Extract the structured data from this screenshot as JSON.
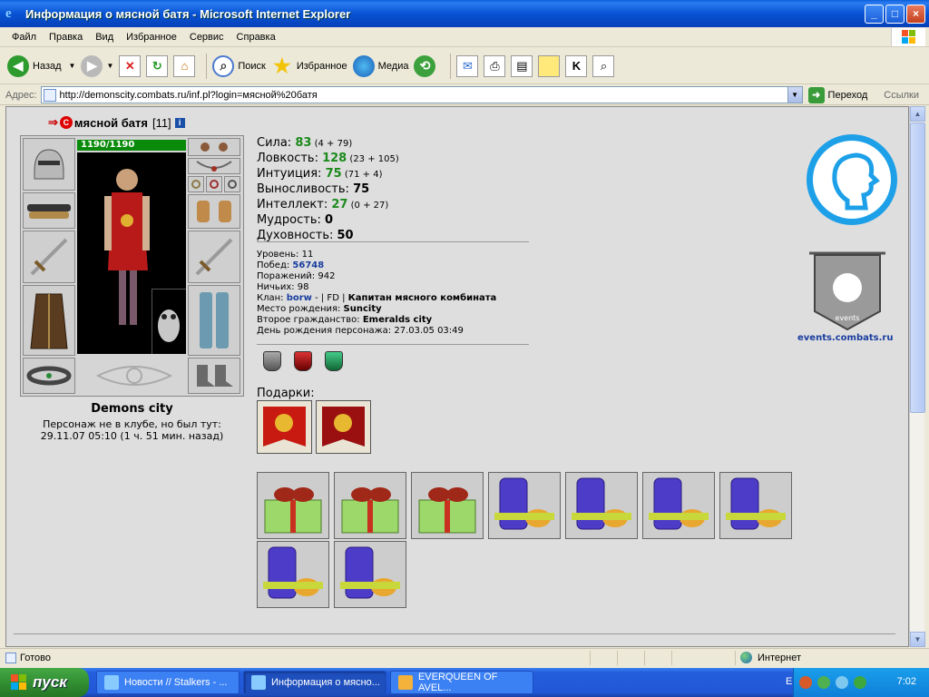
{
  "window": {
    "title": "Информация о мясной батя - Microsoft Internet Explorer"
  },
  "menu": [
    "Файл",
    "Правка",
    "Вид",
    "Избранное",
    "Сервис",
    "Справка"
  ],
  "toolbar": {
    "back": "Назад",
    "search": "Поиск",
    "favorites": "Избранное",
    "media": "Медиа"
  },
  "address": {
    "label": "Адрес:",
    "url": "http://demonscity.combats.ru/inf.pl?login=мясной%20батя",
    "go": "Переход",
    "links": "Ссылки"
  },
  "character": {
    "name": "мясной батя",
    "level": "[11]",
    "hp": "1190/1190",
    "city": "Demons city",
    "online_line1": "Персонаж не в клубе, но был тут:",
    "online_line2": "29.11.07 05:10 (1 ч. 51 мин. назад)"
  },
  "stats": [
    {
      "label": "Сила: ",
      "value": "83",
      "extra": " (4 + 79)",
      "green": true
    },
    {
      "label": "Ловкость: ",
      "value": "128",
      "extra": " (23 + 105)",
      "green": true
    },
    {
      "label": "Интуиция: ",
      "value": "75",
      "extra": " (71 + 4)",
      "green": true
    },
    {
      "label": "Выносливость: ",
      "value": "75",
      "extra": "",
      "green": false
    },
    {
      "label": "Интеллект: ",
      "value": "27",
      "extra": " (0 + 27)",
      "green": true
    },
    {
      "label": "Мудрость: ",
      "value": "0",
      "extra": "",
      "green": false
    },
    {
      "label": "Духовность: ",
      "value": "50",
      "extra": "",
      "green": false
    }
  ],
  "details": {
    "level_label": "Уровень: ",
    "level": "11",
    "wins_label": "Побед: ",
    "wins": "56748",
    "losses_label": "Поражений: ",
    "losses": "942",
    "draws_label": "Ничьих: ",
    "draws": "98",
    "clan_label": "Клан: ",
    "clan": "borw",
    "clan_sep": " - | FD | ",
    "clan_title": "Капитан мясного комбината",
    "birthplace_label": "Место рождения: ",
    "birthplace": "Suncity",
    "second_label": "Второе гражданство: ",
    "second": "Emeralds city",
    "birthday_label": "День рождения персонажа: ",
    "birthday": "27.03.05 03:49"
  },
  "gifts_label": "Подарки:",
  "events_link": "events.combats.ru",
  "events_logo_text": "events",
  "status": {
    "text": "Готово",
    "zone": "Интернет"
  },
  "taskbar": {
    "start": "пуск",
    "tasks": [
      "Новости // Stalkers - ...",
      "Информация о мясно...",
      "EVERQUEEN OF AVEL..."
    ],
    "lang": "EN",
    "clock": "7:02"
  },
  "colors": {
    "accent": "#1da0e8",
    "stat_green": "#1c8a1c",
    "link_blue": "#1a3ea0"
  }
}
